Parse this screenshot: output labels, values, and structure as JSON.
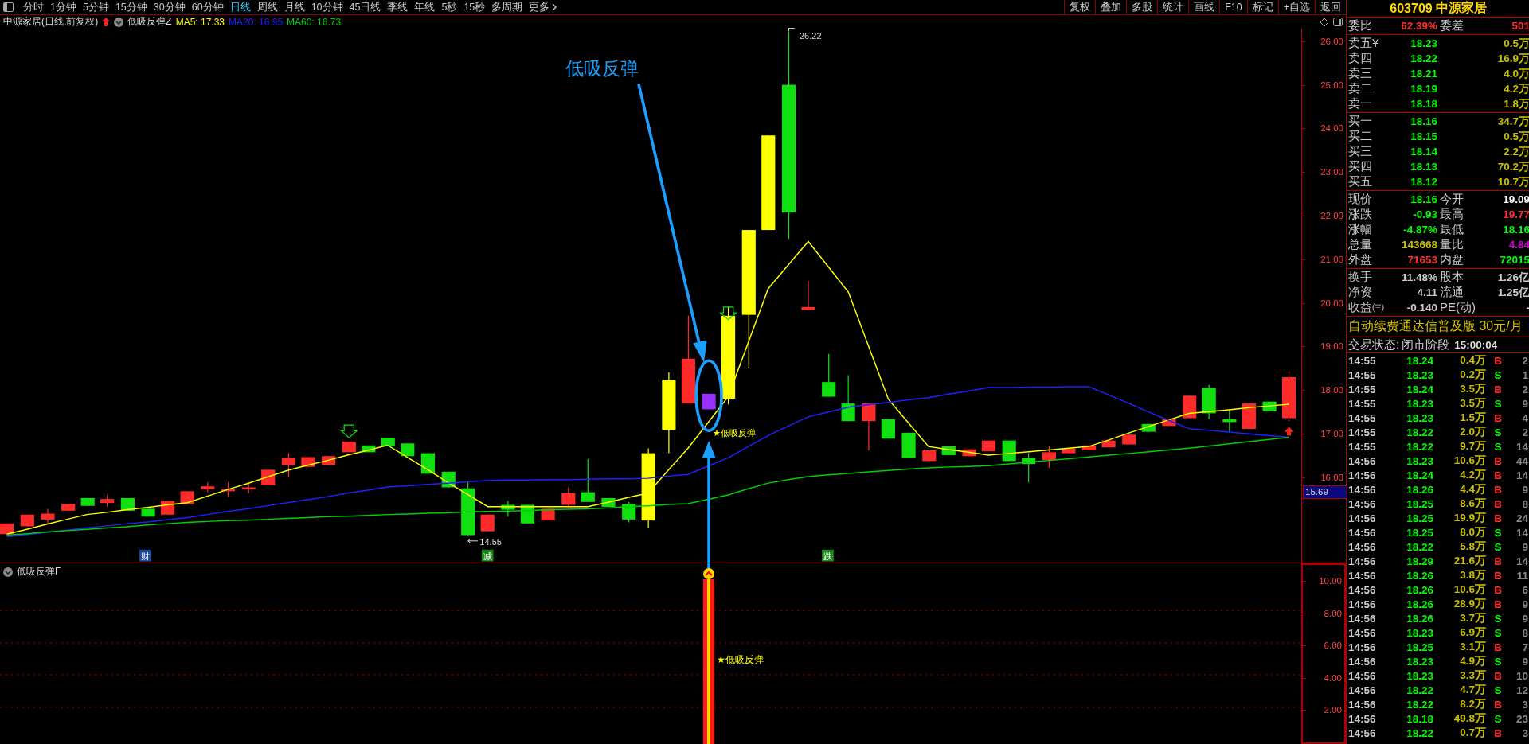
{
  "toolbar": {
    "tabs": [
      {
        "label": "分时",
        "selected": false
      },
      {
        "label": "1分钟",
        "selected": false
      },
      {
        "label": "5分钟",
        "selected": false
      },
      {
        "label": "15分钟",
        "selected": false
      },
      {
        "label": "30分钟",
        "selected": false
      },
      {
        "label": "60分钟",
        "selected": false
      },
      {
        "label": "日线",
        "selected": true
      },
      {
        "label": "周线",
        "selected": false
      },
      {
        "label": "月线",
        "selected": false
      },
      {
        "label": "10分钟",
        "selected": false
      },
      {
        "label": "45日线",
        "selected": false
      },
      {
        "label": "季线",
        "selected": false
      },
      {
        "label": "年线",
        "selected": false
      },
      {
        "label": "5秒",
        "selected": false
      },
      {
        "label": "15秒",
        "selected": false
      },
      {
        "label": "多周期",
        "selected": false
      }
    ],
    "more": "更多",
    "buttons": [
      "复权",
      "叠加",
      "多股",
      "统计",
      "画线",
      "F10",
      "标记",
      "+自选",
      "返回"
    ]
  },
  "chart": {
    "security": "中源家居(日线.前复权)",
    "indicator": "低吸反弹Z",
    "chart_data": {
      "type": "line",
      "ylim": [
        14.03,
        26.29
      ],
      "yticks": [
        {
          "value": 26,
          "label": "26.00"
        },
        {
          "value": 25,
          "label": "25.00"
        },
        {
          "value": 24,
          "label": "24.00"
        },
        {
          "value": 23,
          "label": "23.00"
        },
        {
          "value": 22,
          "label": "22.00"
        },
        {
          "value": 21,
          "label": "21.00"
        },
        {
          "value": 20,
          "label": "20.00"
        },
        {
          "value": 19,
          "label": "19.00"
        },
        {
          "value": 18,
          "label": "18.00"
        },
        {
          "value": 17,
          "label": "17.00"
        },
        {
          "value": 16,
          "label": "16.00"
        }
      ],
      "series": [
        {
          "name": "MA5: 17.33",
          "color": "#ffff00",
          "values": [
            14.7,
            14.81,
            14.93,
            15.04,
            15.15,
            15.2,
            15.26,
            15.31,
            15.37,
            15.42,
            15.57,
            15.72,
            15.86,
            16.01,
            16.16,
            16.28,
            16.39,
            16.51,
            16.62,
            16.74,
            16.46,
            16.18,
            15.89,
            15.61,
            15.33,
            15.33,
            15.33,
            15.33,
            15.33,
            15.33,
            15.43,
            15.54,
            15.64,
            16.16,
            16.67,
            17.26,
            17.85,
            19.09,
            20.33,
            20.87,
            21.41,
            20.83,
            20.25,
            19.02,
            17.79,
            17.25,
            16.71,
            16.64,
            16.58,
            16.51,
            16.55,
            16.59,
            16.63,
            16.67,
            16.71,
            16.86,
            17.02,
            17.17,
            17.32,
            17.47,
            17.51,
            17.55,
            17.6,
            17.64,
            17.68
          ]
        },
        {
          "name": "MA20: 16.95",
          "color": "#2020ff",
          "values": [
            14.64,
            14.69,
            14.74,
            14.79,
            14.84,
            14.89,
            14.94,
            14.98,
            15.03,
            15.08,
            15.15,
            15.22,
            15.28,
            15.35,
            15.42,
            15.49,
            15.56,
            15.64,
            15.71,
            15.78,
            15.81,
            15.84,
            15.87,
            15.9,
            15.93,
            15.94,
            15.94,
            15.95,
            15.95,
            15.96,
            15.97,
            15.97,
            15.98,
            16.03,
            16.07,
            16.26,
            16.45,
            16.71,
            16.96,
            17.18,
            17.39,
            17.5,
            17.61,
            17.67,
            17.72,
            17.78,
            17.83,
            17.91,
            17.98,
            18.06,
            18.06,
            18.07,
            18.07,
            18.08,
            18.08,
            17.89,
            17.7,
            17.5,
            17.31,
            17.12,
            17.08,
            17.04,
            17.0,
            16.96,
            16.92
          ]
        },
        {
          "name": "MA60: 16.73",
          "color": "#00d000",
          "values": [
            14.68,
            14.71,
            14.75,
            14.78,
            14.81,
            14.84,
            14.87,
            14.91,
            14.94,
            14.97,
            14.99,
            15.01,
            15.02,
            15.04,
            15.06,
            15.08,
            15.1,
            15.11,
            15.13,
            15.15,
            15.16,
            15.18,
            15.19,
            15.21,
            15.22,
            15.23,
            15.24,
            15.26,
            15.27,
            15.28,
            15.3,
            15.33,
            15.35,
            15.38,
            15.4,
            15.5,
            15.6,
            15.74,
            15.87,
            15.95,
            16.02,
            16.06,
            16.09,
            16.13,
            16.16,
            16.19,
            16.22,
            16.24,
            16.25,
            16.27,
            16.31,
            16.35,
            16.39,
            16.43,
            16.47,
            16.51,
            16.55,
            16.59,
            16.63,
            16.67,
            16.72,
            16.77,
            16.82,
            16.87,
            16.92
          ]
        }
      ]
    },
    "current_price": "15.69",
    "high_label": "26.22",
    "low_label": "14.55",
    "signal_label": "★低吸反弹",
    "annotation": "低吸反弹",
    "markers": [
      {
        "label": "财",
        "color": "#1e4a9a"
      },
      {
        "label": "减",
        "color": "#1a8a1a"
      },
      {
        "label": "跌",
        "color": "#1a8a1a"
      }
    ]
  },
  "indicator_panel": {
    "title": "低吸反弹F",
    "signal_label": "★低吸反弹",
    "y_labels": [
      "10.00",
      "8.00",
      "6.00",
      "4.00",
      "2.00"
    ]
  },
  "quote": {
    "code": "603709",
    "name": "中源家居",
    "ratio": [
      {
        "label": "委比",
        "value": "62.39%",
        "color": "#ff3030"
      },
      {
        "label": "委差",
        "value": "501",
        "color": "#ff3030"
      }
    ],
    "asks": [
      {
        "label": "卖五",
        "mark": "¥",
        "price": "18.23",
        "volume": "0.5万"
      },
      {
        "label": "卖四",
        "price": "18.22",
        "volume": "16.9万"
      },
      {
        "label": "卖三",
        "price": "18.21",
        "volume": "4.0万"
      },
      {
        "label": "卖二",
        "price": "18.19",
        "volume": "4.2万"
      },
      {
        "label": "卖一",
        "price": "18.18",
        "volume": "1.8万"
      }
    ],
    "bids": [
      {
        "label": "买一",
        "price": "18.16",
        "volume": "34.7万"
      },
      {
        "label": "买二",
        "price": "18.15",
        "volume": "0.5万"
      },
      {
        "label": "买三",
        "price": "18.14",
        "volume": "2.2万"
      },
      {
        "label": "买四",
        "price": "18.13",
        "volume": "70.2万"
      },
      {
        "label": "买五",
        "price": "18.12",
        "volume": "10.7万"
      }
    ],
    "stats": [
      [
        {
          "label": "现价",
          "value": "18.16",
          "color": "#00ff00"
        },
        {
          "label": "今开",
          "value": "19.09",
          "color": "#ffffff"
        }
      ],
      [
        {
          "label": "涨跌",
          "value": "-0.93",
          "color": "#00ff00"
        },
        {
          "label": "最高",
          "value": "19.77",
          "color": "#ff3030"
        }
      ],
      [
        {
          "label": "涨幅",
          "value": "-4.87%",
          "color": "#00ff00"
        },
        {
          "label": "最低",
          "value": "18.16",
          "color": "#00ff00"
        }
      ],
      [
        {
          "label": "总量",
          "value": "143668",
          "color": "#c8c000"
        },
        {
          "label": "量比",
          "value": "4.84",
          "color": "#d000d0"
        }
      ],
      [
        {
          "label": "外盘",
          "value": "71653",
          "color": "#ff3030"
        },
        {
          "label": "内盘",
          "value": "72015",
          "color": "#00ff00"
        }
      ]
    ],
    "fund": [
      [
        {
          "label": "换手",
          "value": "11.48%"
        },
        {
          "label": "股本",
          "value": "1.26亿"
        }
      ],
      [
        {
          "label": "净资",
          "value": "4.11"
        },
        {
          "label": "流通",
          "value": "1.25亿"
        }
      ],
      [
        {
          "label": "收益㈢",
          "value": "-0.140"
        },
        {
          "label": "PE(动)",
          "value": "-"
        }
      ]
    ],
    "promo": "自动续费通达信普及版  30元/月",
    "trade_status": {
      "label": "交易状态:",
      "status": "闭市阶段",
      "time": "15:00:04"
    },
    "ticks": [
      {
        "time": "14:55",
        "price": "18.24",
        "volume": "0.4万",
        "side": "B",
        "color": "#ff3030",
        "count": "2"
      },
      {
        "time": "14:55",
        "price": "18.23",
        "volume": "0.2万",
        "side": "S",
        "color": "#00ff00",
        "count": "1"
      },
      {
        "time": "14:55",
        "price": "18.24",
        "volume": "3.5万",
        "side": "B",
        "color": "#ff3030",
        "count": "2"
      },
      {
        "time": "14:55",
        "price": "18.23",
        "volume": "3.5万",
        "side": "S",
        "color": "#00ff00",
        "count": "9"
      },
      {
        "time": "14:55",
        "price": "18.23",
        "volume": "1.5万",
        "side": "B",
        "color": "#ff3030",
        "count": "4"
      },
      {
        "time": "14:55",
        "price": "18.22",
        "volume": "2.0万",
        "side": "S",
        "color": "#00ff00",
        "count": "2"
      },
      {
        "time": "14:55",
        "price": "18.22",
        "volume": "9.7万",
        "side": "S",
        "color": "#00ff00",
        "count": "14"
      },
      {
        "time": "14:56",
        "price": "18.23",
        "volume": "10.6万",
        "side": "B",
        "color": "#ff3030",
        "count": "44"
      },
      {
        "time": "14:56",
        "price": "18.24",
        "volume": "4.2万",
        "side": "B",
        "color": "#ff3030",
        "count": "14"
      },
      {
        "time": "14:56",
        "price": "18.26",
        "volume": "4.4万",
        "side": "B",
        "color": "#ff3030",
        "count": "9"
      },
      {
        "time": "14:56",
        "price": "18.25",
        "volume": "8.6万",
        "side": "B",
        "color": "#ff3030",
        "count": "8"
      },
      {
        "time": "14:56",
        "price": "18.25",
        "volume": "19.9万",
        "side": "B",
        "color": "#ff3030",
        "count": "24"
      },
      {
        "time": "14:56",
        "price": "18.25",
        "volume": "8.0万",
        "side": "S",
        "color": "#00ff00",
        "count": "14"
      },
      {
        "time": "14:56",
        "price": "18.22",
        "volume": "5.8万",
        "side": "S",
        "color": "#00ff00",
        "count": "9"
      },
      {
        "time": "14:56",
        "price": "18.29",
        "volume": "21.6万",
        "side": "B",
        "color": "#ff3030",
        "count": "14"
      },
      {
        "time": "14:56",
        "price": "18.26",
        "volume": "3.8万",
        "side": "B",
        "color": "#ff3030",
        "count": "11"
      },
      {
        "time": "14:56",
        "price": "18.26",
        "volume": "10.6万",
        "side": "B",
        "color": "#ff3030",
        "count": "6"
      },
      {
        "time": "14:56",
        "price": "18.26",
        "volume": "28.9万",
        "side": "B",
        "color": "#ff3030",
        "count": "9"
      },
      {
        "time": "14:56",
        "price": "18.26",
        "volume": "3.7万",
        "side": "S",
        "color": "#00ff00",
        "count": "9"
      },
      {
        "time": "14:56",
        "price": "18.23",
        "volume": "6.9万",
        "side": "S",
        "color": "#00ff00",
        "count": "8"
      },
      {
        "time": "14:56",
        "price": "18.25",
        "volume": "3.1万",
        "side": "B",
        "color": "#ff3030",
        "count": "7"
      },
      {
        "time": "14:56",
        "price": "18.23",
        "volume": "4.9万",
        "side": "S",
        "color": "#00ff00",
        "count": "9"
      },
      {
        "time": "14:56",
        "price": "18.23",
        "volume": "3.3万",
        "side": "B",
        "color": "#ff3030",
        "count": "10"
      },
      {
        "time": "14:56",
        "price": "18.22",
        "volume": "4.7万",
        "side": "S",
        "color": "#00ff00",
        "count": "12"
      },
      {
        "time": "14:56",
        "price": "18.22",
        "volume": "8.2万",
        "side": "B",
        "color": "#ff3030",
        "count": "3"
      },
      {
        "time": "14:56",
        "price": "18.18",
        "volume": "49.8万",
        "side": "S",
        "color": "#00ff00",
        "count": "23"
      },
      {
        "time": "14:56",
        "price": "18.22",
        "volume": "0.7万",
        "side": "B",
        "color": "#ff3030",
        "count": "3"
      }
    ]
  }
}
